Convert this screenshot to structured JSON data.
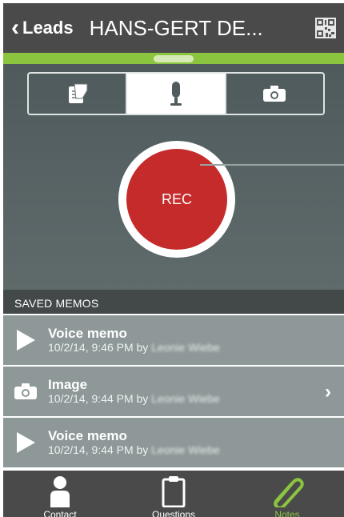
{
  "header": {
    "back_label": "Leads",
    "title": "HANS-GERT DE..."
  },
  "mode_tabs": [
    {
      "icon": "notepad-icon",
      "active": false
    },
    {
      "icon": "microphone-icon",
      "active": true
    },
    {
      "icon": "camera-icon",
      "active": false
    }
  ],
  "recorder": {
    "rec_label": "REC"
  },
  "saved_memos": {
    "section_title": "SAVED MEMOS",
    "items": [
      {
        "type": "voice",
        "icon": "play-icon",
        "title": "Voice memo",
        "timestamp": "10/2/14, 9:46 PM by",
        "author": "Leonie Wiebe"
      },
      {
        "type": "image",
        "icon": "camera-icon",
        "title": "Image",
        "timestamp": "10/2/14, 9:44 PM by",
        "author": "Leonie Wiebe"
      },
      {
        "type": "voice",
        "icon": "play-icon",
        "title": "Voice memo",
        "timestamp": "10/2/14, 9:44 PM by",
        "author": "Leonie Wiebe"
      }
    ]
  },
  "tabbar": {
    "items": [
      {
        "label": "Contact",
        "icon": "person-icon",
        "active": false
      },
      {
        "label": "Questions",
        "icon": "clipboard-icon",
        "active": false
      },
      {
        "label": "Notes",
        "icon": "paperclip-icon",
        "active": true
      }
    ]
  },
  "colors": {
    "header_bg": "#4a4a4a",
    "accent_green": "#8bc43f",
    "rec_red": "#c52b2b",
    "memo_row_bg": "#8e9898"
  }
}
